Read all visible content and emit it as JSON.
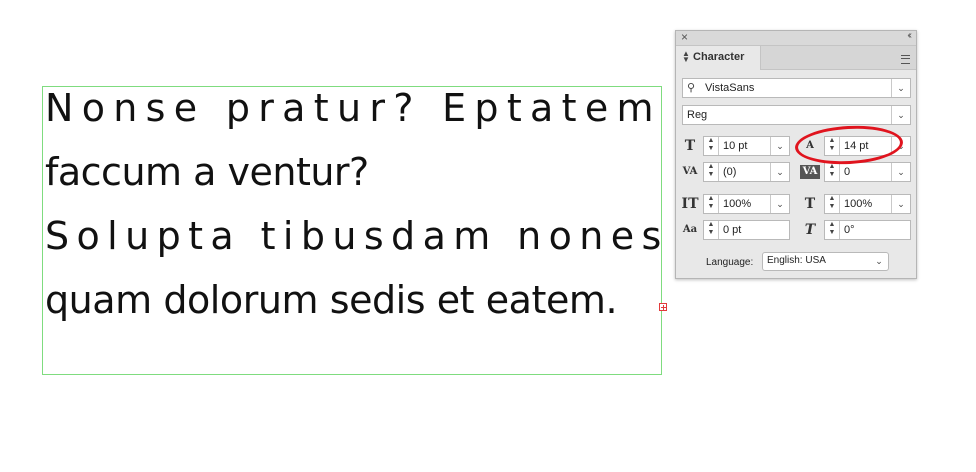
{
  "text_frame": {
    "lines": [
      "Nonse pratur? Eptatem",
      "faccum a ventur?",
      "Solupta tibusdam nones",
      "quam dolorum sedis et eatem."
    ]
  },
  "panel": {
    "title": "Character",
    "font_family": "VistaSans",
    "font_style": "Reg",
    "font_size": "10 pt",
    "leading": "14 pt",
    "kerning": "(0)",
    "tracking": "0",
    "vertical_scale": "100%",
    "horizontal_scale": "100%",
    "baseline_shift": "0 pt",
    "skew": "0°",
    "language_label": "Language:",
    "language": "English: USA"
  },
  "icons": {
    "close": "×",
    "collapse": "‹‹",
    "chevron": "⌄",
    "font_size": "T",
    "leading": "A",
    "kerning": "VA",
    "tracking": "VA",
    "vertical_scale": "IT",
    "horizontal_scale": "T",
    "baseline_shift": "Aa",
    "skew": "T"
  },
  "annotation_color": "#e0141e"
}
